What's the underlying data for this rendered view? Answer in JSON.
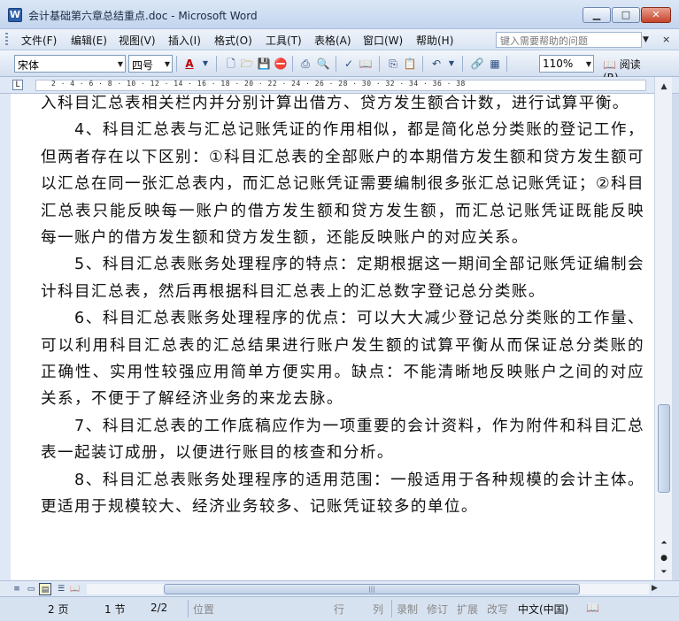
{
  "window": {
    "title": "会计基础第六章总结重点.doc - Microsoft Word",
    "app_icon": "word-doc-icon",
    "controls": {
      "minimize": "▁",
      "maximize": "□",
      "close": "✕"
    }
  },
  "menubar": {
    "items": [
      "文件(F)",
      "编辑(E)",
      "视图(V)",
      "插入(I)",
      "格式(O)",
      "工具(T)",
      "表格(A)",
      "窗口(W)",
      "帮助(H)"
    ],
    "help_placeholder": "键入需要帮助的问题",
    "close_glyph": "×"
  },
  "toolbar": {
    "font_name": "宋体",
    "font_size": "四号",
    "font_color_glyph": "A",
    "zoom": "110%",
    "read_label": "阅读(R)"
  },
  "ruler": {
    "corner": "L",
    "ticks": "2 · 4 · 6 · 8 · 10 · 12 · 14 · 16 · 18 · 20 · 22 · 24 · 26 · 28 · 30 · 32 · 34 · 36 · 38"
  },
  "document": {
    "paragraphs": [
      {
        "indent": false,
        "text": "入科目汇总表相关栏内并分别计算出借方、贷方发生额合计数，进行试算平衡。"
      },
      {
        "indent": true,
        "text": "4、科目汇总表与汇总记账凭证的作用相似，都是简化总分类账的登记工作，但两者存在以下区别：①科目汇总表的全部账户的本期借方发生额和贷方发生额可以汇总在同一张汇总表内，而汇总记账凭证需要编制很多张汇总记账凭证；②科目汇总表只能反映每一账户的借方发生额和贷方发生额，而汇总记账凭证既能反映每一账户的借方发生额和贷方发生额，还能反映账户的对应关系。"
      },
      {
        "indent": true,
        "text": "5、科目汇总表账务处理程序的特点：定期根据这一期间全部记账凭证编制会计科目汇总表，然后再根据科目汇总表上的汇总数字登记总分类账。"
      },
      {
        "indent": true,
        "text": "6、科目汇总表账务处理程序的优点：可以大大减少登记总分类账的工作量、可以利用科目汇总表的汇总结果进行账户发生额的试算平衡从而保证总分类账的正确性、实用性较强应用简单方便实用。缺点：不能清晰地反映账户之间的对应关系，不便于了解经济业务的来龙去脉。"
      },
      {
        "indent": true,
        "text": "7、科目汇总表的工作底稿应作为一项重要的会计资料，作为附件和科目汇总表一起装订成册，以便进行账目的核查和分析。"
      },
      {
        "indent": true,
        "text": "8、科目汇总表账务处理程序的适用范围：一般适用于各种规模的会计主体。更适用于规模较大、经济业务较多、记账凭证较多的单位。"
      }
    ]
  },
  "statusbar": {
    "page": "2 页",
    "section": "1 节",
    "page_of": "2/2",
    "position": "位置",
    "line": "行",
    "column": "列",
    "rec": "录制",
    "trk": "修订",
    "ext": "扩展",
    "ovr": "改写",
    "language": "中文(中国)"
  }
}
